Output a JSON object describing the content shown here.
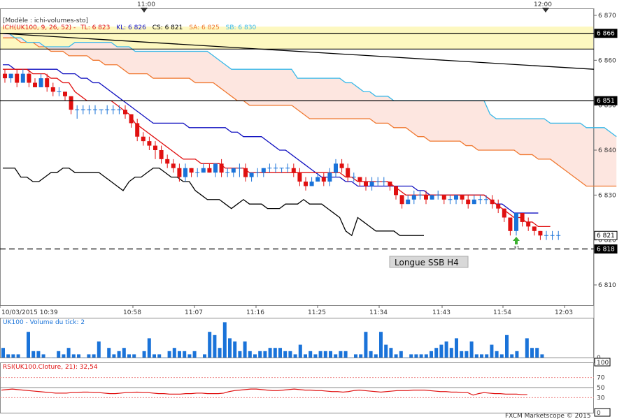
{
  "top_time_markers": [
    "11:00",
    "12:00"
  ],
  "legend": {
    "template": "[Modèle : ichi-volumes-sto]",
    "ich_name": "ICH(UK100, 9, 26, 52) -",
    "tl": "TL: 6 823",
    "kl": "KL: 6 826",
    "cs": "CS: 6 821",
    "sa": "SA: 6 825",
    "sb": "SB: 6 830"
  },
  "price_axis": {
    "ticks": [
      "6 870",
      "6 860",
      "6 850",
      "6 840",
      "6 830",
      "6 820",
      "6 810"
    ],
    "tags": [
      "6 866",
      "6 851",
      "6 821",
      "6 818"
    ]
  },
  "annotation": {
    "text": "Longue SSB H4",
    "signal_number": "31"
  },
  "time_axis": {
    "labels": [
      "10/03/2015 10:39",
      "10:58",
      "11:07",
      "11:16",
      "11:25",
      "11:34",
      "11:43",
      "11:54",
      "12:03"
    ]
  },
  "volume_panel": {
    "title": "UK100 - Volume du tick: 2",
    "axis_zero": "0"
  },
  "rsi_panel": {
    "title": "RSI(UK100.Cloture, 21): 32,54",
    "levels": [
      "100",
      "70",
      "50",
      "30",
      "0"
    ]
  },
  "footer": "FXCM Marketscope © 2015",
  "colors": {
    "bull": "#1a73d9",
    "bear": "#e01010",
    "tenkan": "#e01010",
    "kijun": "#1010c0",
    "senkou_a": "#f07830",
    "senkou_b": "#38b8e8",
    "chikou": "#000000",
    "cloud": "#fde6e0",
    "band": "#fdf8c0"
  },
  "chart_data": {
    "type": "candlestick",
    "price_range": [
      6806,
      6872
    ],
    "highlighted_band": [
      6862.5,
      6867.5
    ],
    "horizontal_levels": [
      6866,
      6851,
      6818
    ],
    "candles": [
      [
        6857,
        6856,
        6858,
        6855
      ],
      [
        6856,
        6857,
        6857,
        6855
      ],
      [
        6857,
        6855,
        6858,
        6854
      ],
      [
        6855,
        6857,
        6858,
        6855
      ],
      [
        6857,
        6855,
        6858,
        6854
      ],
      [
        6855,
        6854,
        6856,
        6854
      ],
      [
        6854,
        6856,
        6857,
        6854
      ],
      [
        6856,
        6854,
        6857,
        6853
      ],
      [
        6854,
        6853,
        6855,
        6852
      ],
      [
        6853,
        6853,
        6854,
        6852
      ],
      [
        6853,
        6852,
        6853,
        6851
      ],
      [
        6852,
        6849,
        6852,
        6848
      ],
      [
        6849,
        6849,
        6850,
        6847
      ],
      [
        6849,
        6849,
        6850,
        6848
      ],
      [
        6849,
        6849,
        6850,
        6848
      ],
      [
        6849,
        6849,
        6850,
        6848
      ],
      [
        6849,
        6849,
        6849,
        6848
      ],
      [
        6849,
        6849,
        6850,
        6848
      ],
      [
        6849,
        6849,
        6850,
        6848
      ],
      [
        6849,
        6849,
        6850,
        6848
      ],
      [
        6849,
        6848,
        6850,
        6847
      ],
      [
        6848,
        6846,
        6848,
        6845
      ],
      [
        6846,
        6843,
        6847,
        6842
      ],
      [
        6843,
        6842,
        6844,
        6841
      ],
      [
        6842,
        6841,
        6843,
        6840
      ],
      [
        6841,
        6840,
        6842,
        6838
      ],
      [
        6840,
        6838,
        6841,
        6837
      ],
      [
        6838,
        6837,
        6839,
        6836
      ],
      [
        6837,
        6836,
        6838,
        6835
      ],
      [
        6836,
        6834,
        6837,
        6833
      ],
      [
        6834,
        6836,
        6837,
        6833
      ],
      [
        6836,
        6835,
        6836,
        6834
      ],
      [
        6835,
        6835,
        6836,
        6834
      ],
      [
        6835,
        6836,
        6837,
        6835
      ],
      [
        6836,
        6835,
        6837,
        6835
      ],
      [
        6835,
        6837,
        6837,
        6834
      ],
      [
        6837,
        6835,
        6838,
        6834
      ],
      [
        6835,
        6835,
        6836,
        6834
      ],
      [
        6835,
        6836,
        6836,
        6834
      ],
      [
        6836,
        6836,
        6837,
        6834
      ],
      [
        6836,
        6834,
        6837,
        6833
      ],
      [
        6834,
        6835,
        6835,
        6833
      ],
      [
        6835,
        6835,
        6836,
        6834
      ],
      [
        6835,
        6836,
        6836,
        6834
      ],
      [
        6836,
        6836,
        6837,
        6835
      ],
      [
        6836,
        6836,
        6837,
        6835
      ],
      [
        6836,
        6836,
        6836,
        6835
      ],
      [
        6836,
        6836,
        6837,
        6835
      ],
      [
        6836,
        6835,
        6837,
        6834
      ],
      [
        6835,
        6833,
        6836,
        6832
      ],
      [
        6833,
        6832,
        6834,
        6831
      ],
      [
        6832,
        6833,
        6834,
        6832
      ],
      [
        6833,
        6834,
        6835,
        6833
      ],
      [
        6834,
        6833,
        6835,
        6832
      ],
      [
        6833,
        6835,
        6836,
        6832
      ],
      [
        6835,
        6837,
        6838,
        6834
      ],
      [
        6837,
        6836,
        6838,
        6835
      ],
      [
        6836,
        6834,
        6837,
        6833
      ],
      [
        6834,
        6834,
        6835,
        6833
      ],
      [
        6834,
        6833,
        6834,
        6832
      ],
      [
        6833,
        6832,
        6834,
        6831
      ],
      [
        6832,
        6833,
        6834,
        6831
      ],
      [
        6833,
        6833,
        6834,
        6832
      ],
      [
        6833,
        6833,
        6834,
        6832
      ],
      [
        6833,
        6832,
        6833,
        6831
      ],
      [
        6832,
        6830,
        6832,
        6829
      ],
      [
        6830,
        6828,
        6830,
        6827
      ],
      [
        6828,
        6829,
        6830,
        6828
      ],
      [
        6829,
        6830,
        6831,
        6828
      ],
      [
        6830,
        6830,
        6831,
        6829
      ],
      [
        6830,
        6829,
        6831,
        6828
      ],
      [
        6829,
        6830,
        6830,
        6829
      ],
      [
        6830,
        6830,
        6831,
        6829
      ],
      [
        6830,
        6829,
        6830,
        6828
      ],
      [
        6829,
        6829,
        6830,
        6828
      ],
      [
        6829,
        6830,
        6830,
        6828
      ],
      [
        6830,
        6829,
        6830,
        6828
      ],
      [
        6829,
        6828,
        6830,
        6827
      ],
      [
        6828,
        6829,
        6830,
        6828
      ],
      [
        6829,
        6829,
        6830,
        6828
      ],
      [
        6829,
        6829,
        6830,
        6828
      ],
      [
        6829,
        6828,
        6830,
        6827
      ],
      [
        6828,
        6827,
        6829,
        6826
      ],
      [
        6827,
        6825,
        6827,
        6824
      ],
      [
        6825,
        6822,
        6825,
        6821
      ],
      [
        6822,
        6826,
        6826,
        6821
      ],
      [
        6826,
        6824,
        6826,
        6823
      ],
      [
        6824,
        6823,
        6825,
        6822
      ],
      [
        6823,
        6822,
        6823,
        6821
      ],
      [
        6822,
        6821,
        6822,
        6820
      ],
      [
        6821,
        6821,
        6822,
        6820
      ],
      [
        6821,
        6821,
        6822,
        6820
      ],
      [
        6821,
        6821,
        6822,
        6820
      ]
    ],
    "tenkan": [
      6858,
      6858,
      6858,
      6858,
      6858,
      6857,
      6857,
      6857,
      6856,
      6856,
      6855,
      6855,
      6853,
      6852,
      6851,
      6851,
      6851,
      6851,
      6851,
      6850,
      6849,
      6848,
      6846,
      6845,
      6844,
      6843,
      6842,
      6841,
      6840,
      6839,
      6838,
      6838,
      6838,
      6837,
      6837,
      6837,
      6837,
      6836,
      6836,
      6836,
      6836,
      6835,
      6835,
      6835,
      6835,
      6835,
      6835,
      6835,
      6835,
      6835,
      6835,
      6835,
      6835,
      6835,
      6835,
      6835,
      6835,
      6834,
      6834,
      6833,
      6833,
      6833,
      6833,
      6833,
      6833,
      6832,
      6831,
      6830,
      6830,
      6830,
      6830,
      6830,
      6830,
      6830,
      6830,
      6830,
      6830,
      6830,
      6830,
      6830,
      6830,
      6829,
      6828,
      6827,
      6826,
      6825,
      6825,
      6824,
      6824,
      6823,
      6823,
      6823
    ],
    "kijun": [
      6859,
      6859,
      6858,
      6858,
      6858,
      6858,
      6858,
      6858,
      6858,
      6858,
      6857,
      6857,
      6857,
      6856,
      6856,
      6855,
      6855,
      6854,
      6853,
      6852,
      6851,
      6850,
      6849,
      6848,
      6847,
      6846,
      6846,
      6846,
      6846,
      6846,
      6846,
      6845,
      6845,
      6845,
      6845,
      6845,
      6845,
      6845,
      6844,
      6844,
      6843,
      6843,
      6843,
      6843,
      6842,
      6841,
      6840,
      6840,
      6839,
      6838,
      6837,
      6836,
      6835,
      6834,
      6834,
      6834,
      6834,
      6833,
      6833,
      6832,
      6832,
      6832,
      6832,
      6832,
      6832,
      6832,
      6832,
      6832,
      6832,
      6831,
      6831,
      6830,
      6830,
      6830,
      6830,
      6830,
      6830,
      6830,
      6830,
      6830,
      6830,
      6829,
      6828,
      6828,
      6827,
      6826,
      6826,
      6826,
      6826,
      6826
    ],
    "senkou_a": [
      6865,
      6865,
      6865,
      6864,
      6864,
      6864,
      6863,
      6863,
      6862,
      6862,
      6862,
      6861,
      6861,
      6861,
      6861,
      6860,
      6860,
      6859,
      6859,
      6859,
      6858,
      6857,
      6857,
      6857,
      6857,
      6856,
      6856,
      6856,
      6856,
      6856,
      6856,
      6856,
      6855,
      6855,
      6855,
      6855,
      6854,
      6853,
      6852,
      6851,
      6851,
      6850,
      6850,
      6850,
      6850,
      6850,
      6850,
      6850,
      6850,
      6849,
      6848,
      6847,
      6847,
      6847,
      6847,
      6847,
      6847,
      6847,
      6847,
      6847,
      6847,
      6847,
      6846,
      6846,
      6846,
      6845,
      6845,
      6845,
      6844,
      6843,
      6843,
      6842,
      6842,
      6842,
      6842,
      6842,
      6842,
      6841,
      6841,
      6840,
      6840,
      6840,
      6840,
      6840,
      6840,
      6840,
      6839,
      6839,
      6839,
      6838,
      6838,
      6838,
      6837,
      6836,
      6835,
      6834,
      6833,
      6832,
      6832,
      6832,
      6832,
      6832,
      6832
    ],
    "senkou_b": [
      6866,
      6866,
      6865,
      6865,
      6864,
      6864,
      6864,
      6863,
      6863,
      6863,
      6863,
      6863,
      6864,
      6864,
      6864,
      6864,
      6864,
      6864,
      6864,
      6863,
      6863,
      6863,
      6862,
      6862,
      6862,
      6862,
      6862,
      6862,
      6862,
      6862,
      6862,
      6862,
      6862,
      6862,
      6862,
      6861,
      6860,
      6859,
      6858,
      6858,
      6858,
      6858,
      6858,
      6858,
      6858,
      6858,
      6858,
      6858,
      6858,
      6856,
      6856,
      6856,
      6856,
      6856,
      6856,
      6856,
      6856,
      6855,
      6855,
      6854,
      6853,
      6853,
      6852,
      6852,
      6852,
      6851,
      6851,
      6851,
      6851,
      6851,
      6851,
      6851,
      6851,
      6851,
      6851,
      6851,
      6851,
      6851,
      6851,
      6851,
      6851,
      6848,
      6847,
      6847,
      6847,
      6847,
      6847,
      6847,
      6847,
      6847,
      6847,
      6846,
      6846,
      6846,
      6846,
      6846,
      6846,
      6845,
      6845,
      6845,
      6845,
      6844,
      6843
    ],
    "chikou": [
      6836,
      6836,
      6836,
      6834,
      6834,
      6833,
      6833,
      6834,
      6835,
      6835,
      6836,
      6836,
      6835,
      6835,
      6835,
      6835,
      6835,
      6834,
      6833,
      6832,
      6831,
      6833,
      6834,
      6834,
      6835,
      6836,
      6836,
      6835,
      6834,
      6834,
      6833,
      6833,
      6831,
      6830,
      6829,
      6829,
      6829,
      6828,
      6827,
      6828,
      6829,
      6828,
      6828,
      6828,
      6827,
      6827,
      6827,
      6828,
      6828,
      6828,
      6829,
      6828,
      6828,
      6828,
      6827,
      6826,
      6825,
      6822,
      6821,
      6825,
      6824,
      6823,
      6822,
      6822,
      6822,
      6822,
      6821,
      6821,
      6821,
      6821,
      6821
    ],
    "descending_line": [
      6866,
      6858
    ],
    "volumes": [
      3,
      1,
      1,
      1,
      0,
      8,
      2,
      2,
      1,
      0,
      0,
      2,
      1,
      3,
      1,
      1,
      0,
      1,
      1,
      5,
      0,
      3,
      1,
      2,
      3,
      1,
      1,
      0,
      2,
      6,
      1,
      1,
      0,
      2,
      3,
      2,
      2,
      1,
      2,
      0,
      1,
      8,
      7,
      3,
      11,
      6,
      5,
      2,
      5,
      2,
      1,
      2,
      2,
      3,
      3,
      3,
      2,
      2,
      1,
      4,
      1,
      2,
      1,
      2,
      2,
      2,
      1,
      2,
      2,
      0,
      1,
      1,
      8,
      2,
      1,
      8,
      4,
      3,
      1,
      2,
      0,
      1,
      1,
      1,
      1,
      2,
      3,
      4,
      5,
      3,
      6,
      2,
      2,
      5,
      1,
      1,
      1,
      4,
      2,
      1,
      7,
      1,
      2,
      0,
      6,
      3,
      3,
      1
    ],
    "rsi": [
      45,
      46,
      47,
      46,
      45,
      44,
      43,
      42,
      41,
      40,
      39,
      39,
      39,
      40,
      40,
      41,
      41,
      40,
      40,
      39,
      38,
      38,
      39,
      40,
      40,
      41,
      40,
      40,
      39,
      38,
      38,
      37,
      37,
      37,
      38,
      38,
      39,
      39,
      38,
      38,
      38,
      39,
      42,
      44,
      45,
      46,
      47,
      47,
      46,
      45,
      44,
      44,
      45,
      46,
      47,
      46,
      45,
      45,
      44,
      44,
      43,
      42,
      42,
      41,
      42,
      44,
      45,
      44,
      43,
      42,
      41,
      42,
      43,
      44,
      44,
      44,
      45,
      45,
      45,
      44,
      43,
      42,
      42,
      41,
      41,
      40,
      40,
      35,
      38,
      40,
      39,
      38,
      38,
      37,
      37,
      37,
      36,
      36
    ]
  }
}
